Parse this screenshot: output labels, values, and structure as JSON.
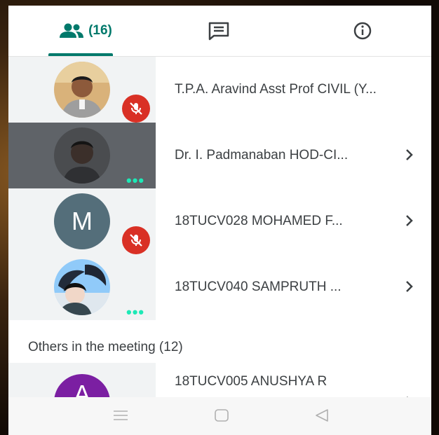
{
  "tabs": {
    "people_count": "(16)",
    "chat_icon": "chat-icon",
    "info_icon": "info-icon"
  },
  "participants": [
    {
      "name": "T.P.A. Aravind Asst Prof CIVIL (Y...",
      "status": "muted"
    },
    {
      "name": "Dr. I. Padmanaban HOD-CI...",
      "status": "more"
    },
    {
      "name": "18TUCV028 MOHAMED F...",
      "status": "muted",
      "initial": "M"
    },
    {
      "name": "18TUCV040 SAMPRUTH ...",
      "status": "more"
    }
  ],
  "section": {
    "label": "Others in the meeting (12)"
  },
  "others": [
    {
      "name": "18TUCV005 ANUSHYA R",
      "initial": "A"
    }
  ],
  "colors": {
    "accent": "#00796b",
    "mute_red": "#d93025",
    "dots_teal": "#1de9b6",
    "letter_avatar": "#546e7a",
    "purple_avatar": "#7b1fa2"
  }
}
